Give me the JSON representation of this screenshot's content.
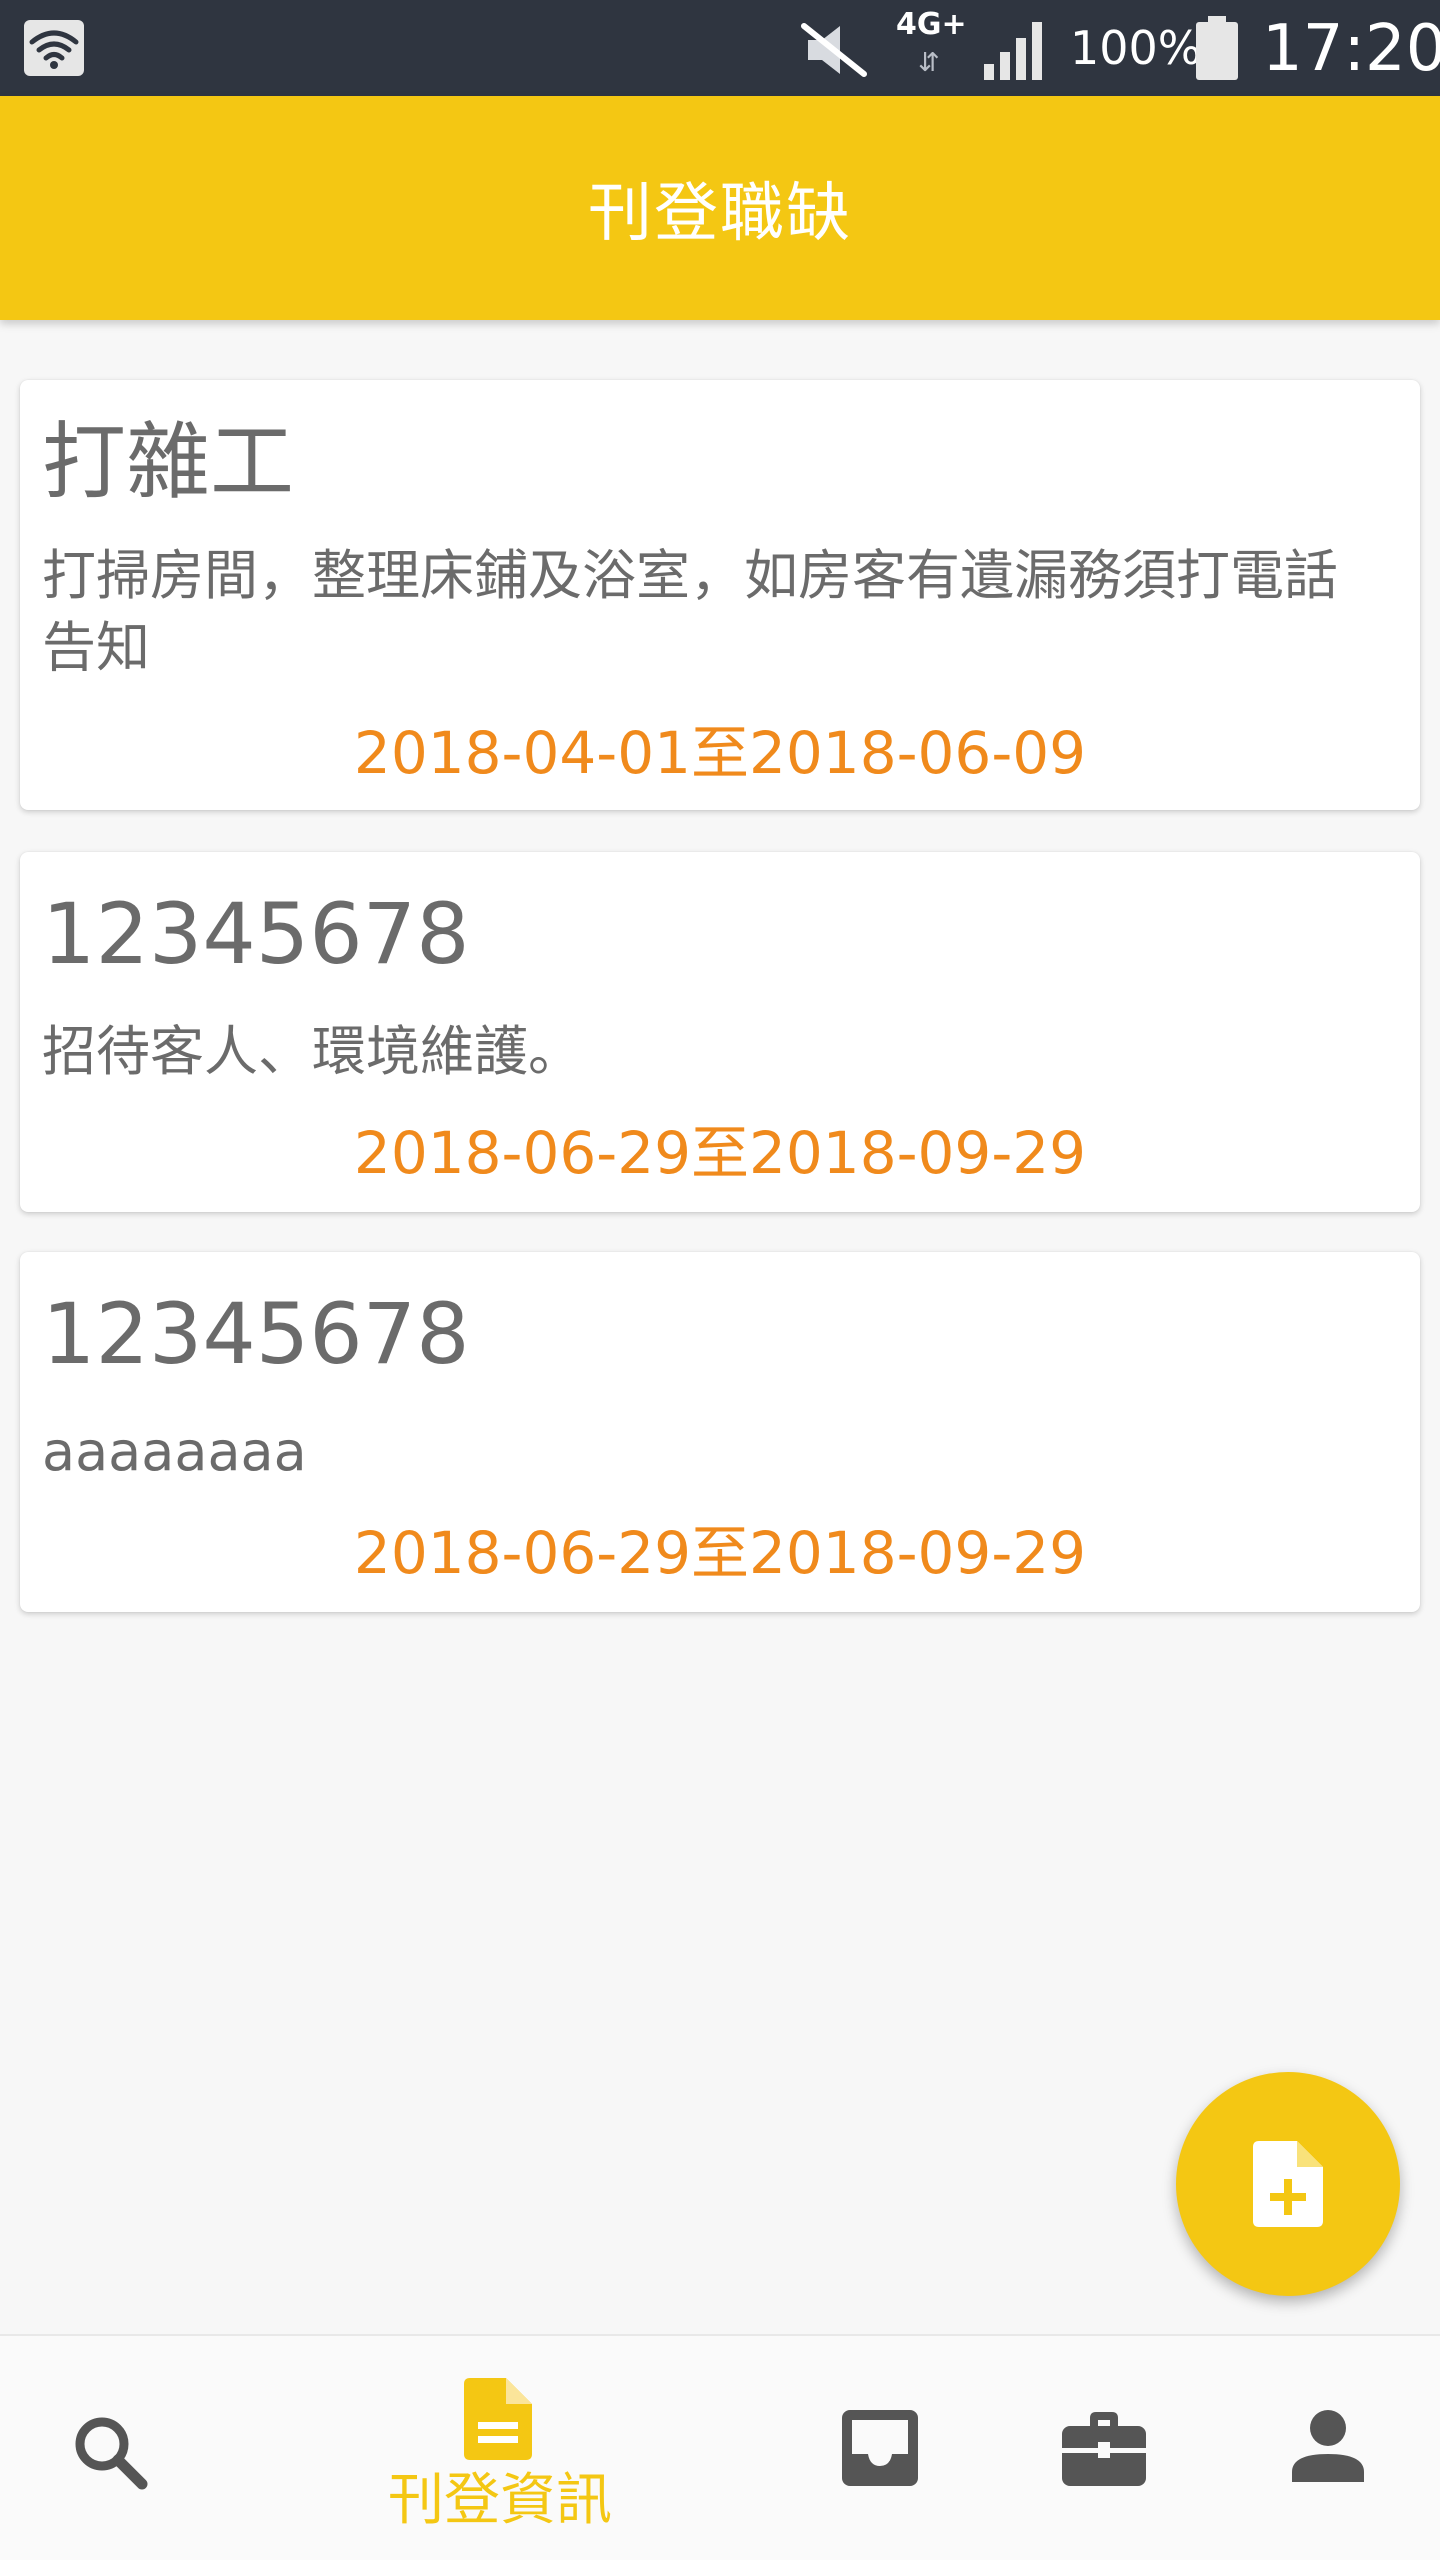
{
  "status_bar": {
    "network_type": "4G+",
    "network_arrows": "⇵",
    "battery_percent": "100%",
    "time": "17:20",
    "icons": [
      "wifi-icon",
      "mute-icon",
      "signal-icon",
      "battery-icon"
    ]
  },
  "app_bar": {
    "title": "刊登職缺"
  },
  "jobs": [
    {
      "title": "打雜工",
      "description": "打掃房間，整理床鋪及浴室，如房客有遺漏務須打電話告知",
      "date_range": "2018-04-01至2018-06-09"
    },
    {
      "title": "12345678",
      "description": "招待客人、環境維護。",
      "date_range": "2018-06-29至2018-09-29"
    },
    {
      "title": "12345678",
      "description": "aaaaaaaa",
      "date_range": "2018-06-29至2018-09-29"
    }
  ],
  "fab": {
    "icon": "add-document-icon"
  },
  "bottom_nav": {
    "items": [
      {
        "icon": "search-icon",
        "label": ""
      },
      {
        "icon": "document-icon",
        "label": "刊登資訊",
        "active": true
      },
      {
        "icon": "inbox-icon",
        "label": ""
      },
      {
        "icon": "briefcase-icon",
        "label": ""
      },
      {
        "icon": "person-icon",
        "label": ""
      }
    ]
  },
  "colors": {
    "accent": "#f4c713",
    "status_bar": "#2f3540",
    "date_text": "#f08a1c",
    "body_text": "#6b6b6b",
    "inactive_icon": "#555555"
  }
}
